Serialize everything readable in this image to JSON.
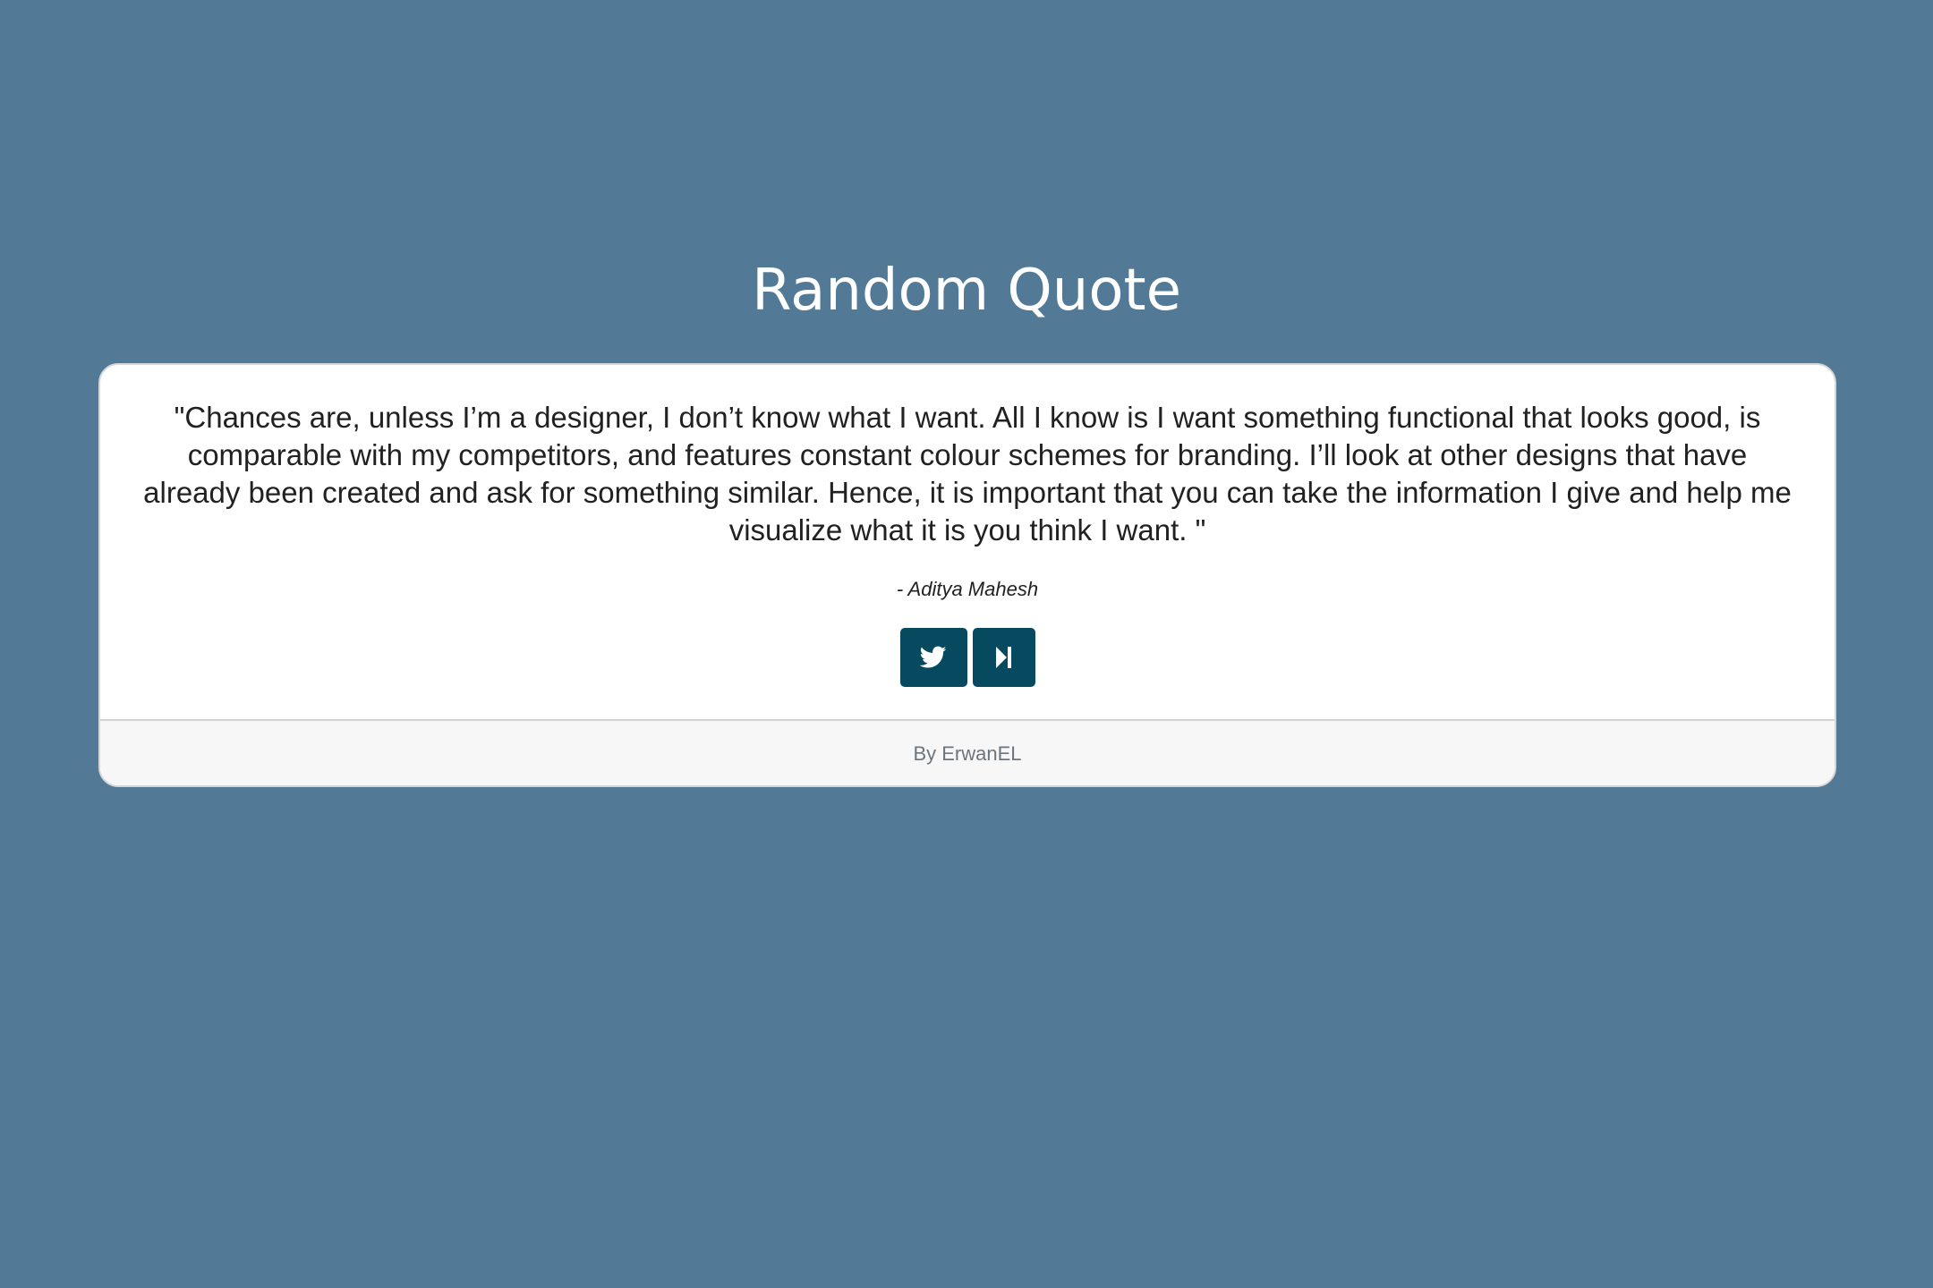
{
  "page": {
    "title": "Random Quote",
    "background_color": "#527a97"
  },
  "quote": {
    "text": "\"Chances are, unless I’m a designer, I don’t know what I want. All I know is I want something functional that looks good, is comparable with my competitors, and features constant colour schemes for branding. I’ll look at other designs that have already been created and ask for something similar. Hence, it is important that you can take the information I give and help me visualize what it is you think I want. \"",
    "author": "- Aditya Mahesh"
  },
  "actions": {
    "tweet_icon": "twitter-icon",
    "next_icon": "skip-next-icon",
    "button_color": "#074a5f"
  },
  "footer": {
    "credit": "By ErwanEL"
  }
}
